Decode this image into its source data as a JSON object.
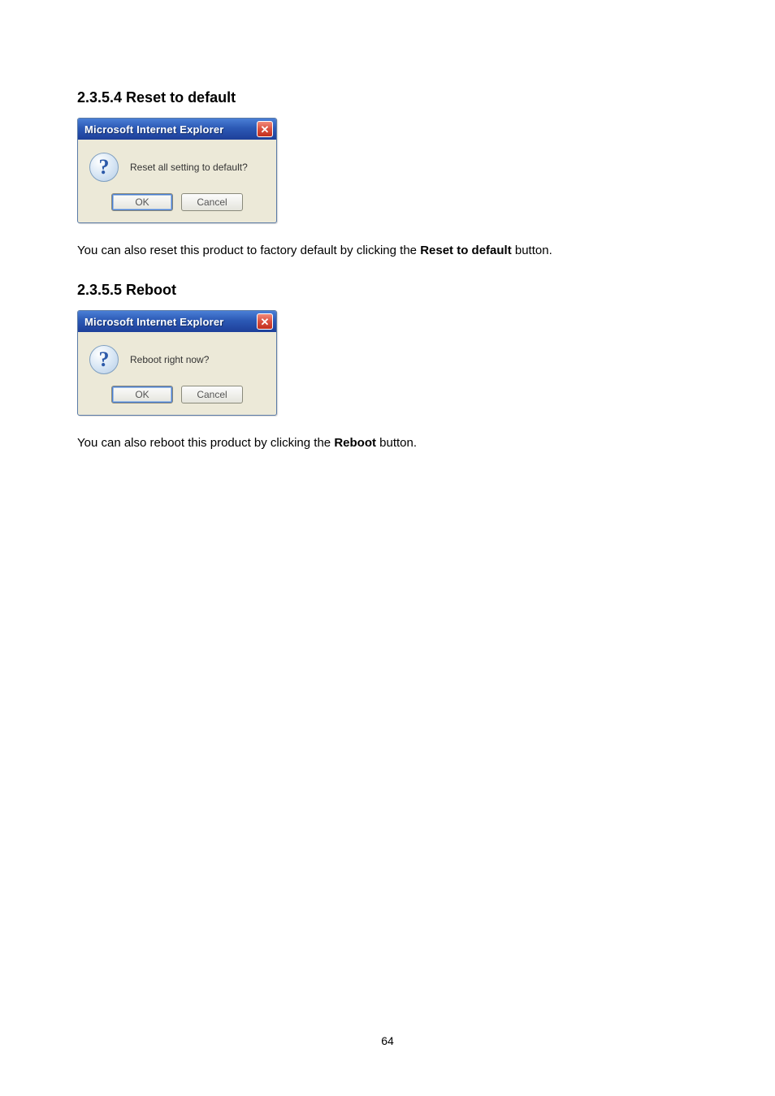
{
  "section1": {
    "heading": "2.3.5.4 Reset to default",
    "dialog": {
      "title": "Microsoft Internet Explorer",
      "message": "Reset all setting to default?",
      "ok": "OK",
      "cancel": "Cancel"
    },
    "body_pre": "You can also reset this product to factory default by clicking the ",
    "body_bold": "Reset to default",
    "body_post": " button."
  },
  "section2": {
    "heading": "2.3.5.5 Reboot",
    "dialog": {
      "title": "Microsoft Internet Explorer",
      "message": "Reboot right now?",
      "ok": "OK",
      "cancel": "Cancel"
    },
    "body_pre": "You can also reboot this product by clicking the ",
    "body_bold": "Reboot",
    "body_post": " button."
  },
  "page_number": "64"
}
